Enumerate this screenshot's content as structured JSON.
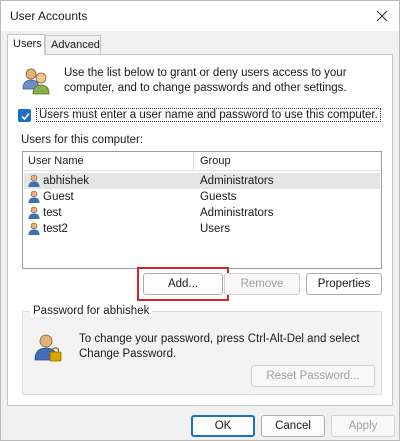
{
  "window": {
    "title": "User Accounts"
  },
  "tabs": [
    {
      "label": "Users",
      "active": true
    },
    {
      "label": "Advanced",
      "active": false
    }
  ],
  "intro": {
    "icon": "users-icon",
    "text": "Use the list below to grant or deny users access to your computer, and to change passwords and other settings."
  },
  "require_login": {
    "checked": true,
    "label": "Users must enter a user name and password to use this computer."
  },
  "users_section": {
    "label": "Users for this computer:",
    "columns": [
      "User Name",
      "Group"
    ],
    "rows": [
      {
        "name": "abhishek",
        "group": "Administrators",
        "selected": true
      },
      {
        "name": "Guest",
        "group": "Guests",
        "selected": false
      },
      {
        "name": "test",
        "group": "Administrators",
        "selected": false
      },
      {
        "name": "test2",
        "group": "Users",
        "selected": false
      }
    ]
  },
  "user_buttons": {
    "add": "Add...",
    "remove": "Remove",
    "properties": "Properties"
  },
  "password_group": {
    "title": "Password for abhishek",
    "icon": "password-user-icon",
    "text": "To change your password, press Ctrl-Alt-Del and select Change Password.",
    "reset_button": "Reset Password..."
  },
  "dialog_buttons": {
    "ok": "OK",
    "cancel": "Cancel",
    "apply": "Apply"
  },
  "colors": {
    "accent": "#1a6fc4",
    "highlight": "#d6242f"
  }
}
